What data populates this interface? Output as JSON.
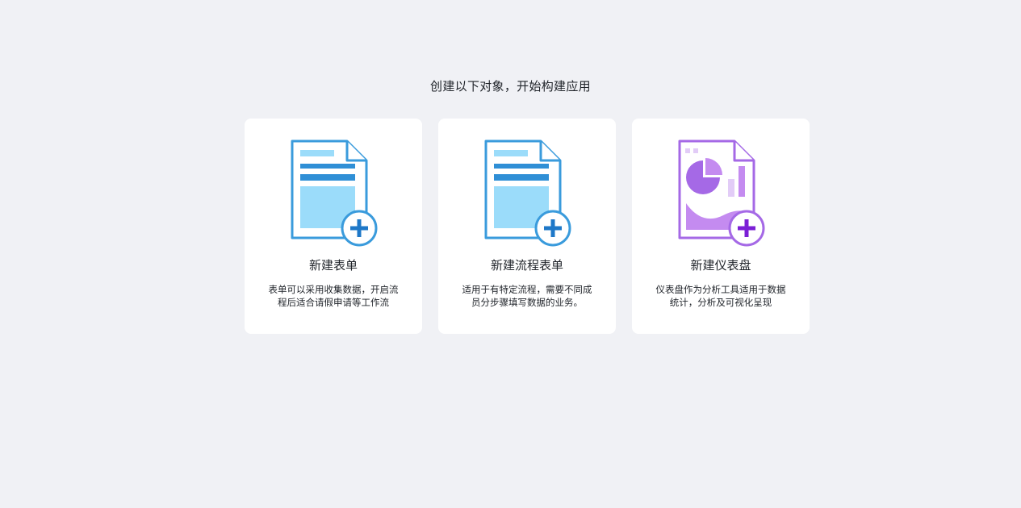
{
  "heading": "创建以下对象，开始构建应用",
  "cards": [
    {
      "title": "新建表单",
      "description": "表单可以采用收集数据，开启流程后适合请假申请等工作流",
      "icon": "form-document-icon",
      "accent": "#3a9bdc"
    },
    {
      "title": "新建流程表单",
      "description": "适用于有特定流程，需要不同成员分步骤填写数据的业务。",
      "icon": "process-form-document-icon",
      "accent": "#3a9bdc"
    },
    {
      "title": "新建仪表盘",
      "description": "仪表盘作为分析工具适用于数据统计，分析及可视化呈现",
      "icon": "dashboard-document-icon",
      "accent": "#a569e6"
    }
  ],
  "colors": {
    "background": "#f0f1f5",
    "card": "#ffffff",
    "blue_outline": "#3a9bdc",
    "blue_fill": "#9bdcfa",
    "blue_plus": "#1e78c8",
    "purple_outline": "#a569e6",
    "purple_fill": "#c48bf0",
    "purple_plus": "#7b1fd6"
  }
}
